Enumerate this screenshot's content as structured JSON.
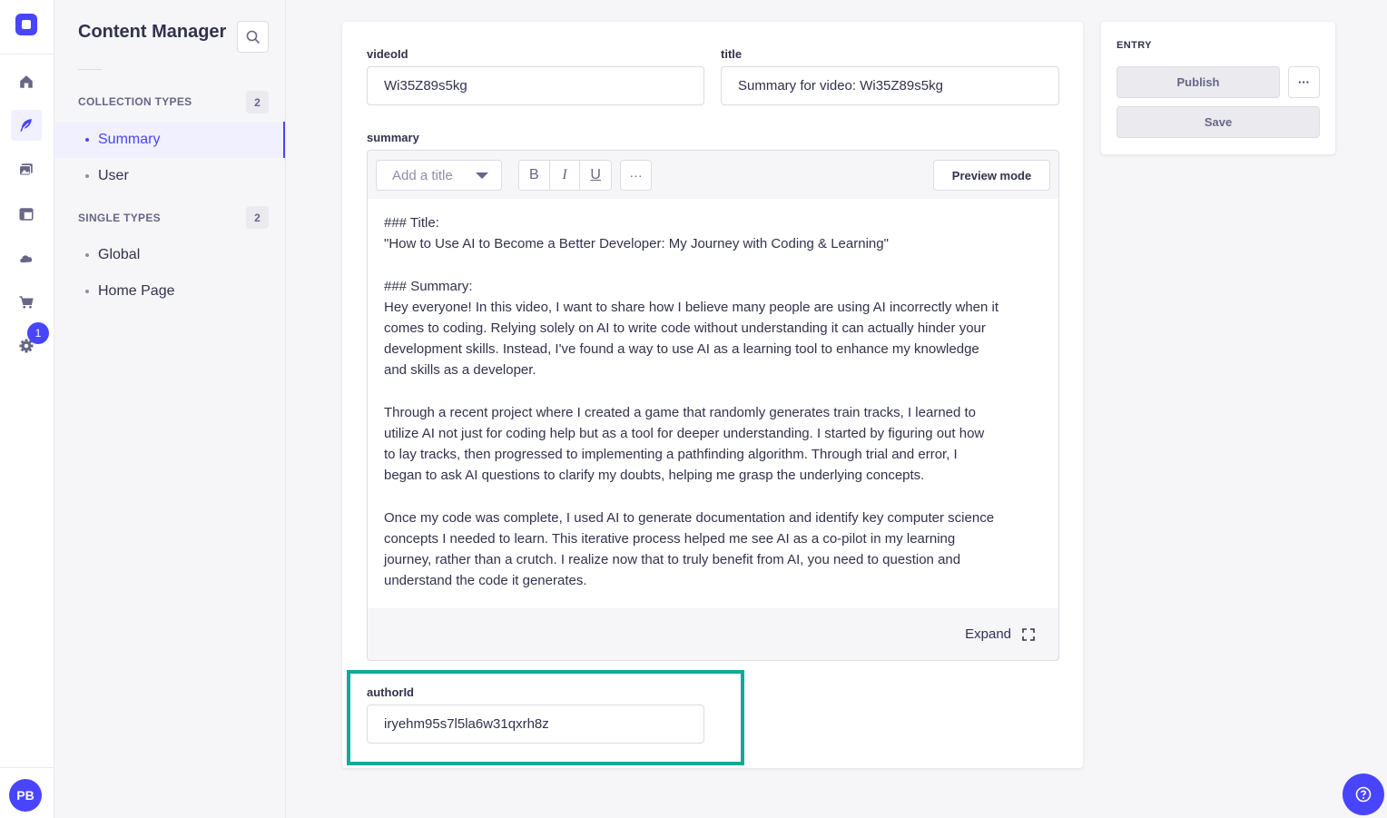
{
  "app": {
    "avatar_initials": "PB",
    "settings_badge": "1",
    "accent_color": "#4945ff",
    "highlight_color": "#14a89a"
  },
  "rail": {
    "icons": [
      "home-icon",
      "feather-icon",
      "media-icon",
      "layout-icon",
      "cloud-icon",
      "cart-icon",
      "gear-icon"
    ]
  },
  "sidebar": {
    "title": "Content Manager",
    "collection_label": "COLLECTION TYPES",
    "collection_count": "2",
    "collection_items": [
      "Summary",
      "User"
    ],
    "single_label": "SINGLE TYPES",
    "single_count": "2",
    "single_items": [
      "Global",
      "Home Page"
    ]
  },
  "form": {
    "videoId_label": "videoId",
    "videoId_value": "Wi35Z89s5kg",
    "title_label": "title",
    "title_value": "Summary for video: Wi35Z89s5kg",
    "summary_label": "summary",
    "editor": {
      "heading_placeholder": "Add a title",
      "bold": "B",
      "italic": "I",
      "underline": "U",
      "more": "···",
      "preview": "Preview mode",
      "expand": "Expand",
      "content": "### Title:\n\"How to Use AI to Become a Better Developer: My Journey with Coding & Learning\"\n\n### Summary:\nHey everyone! In this video, I want to share how I believe many people are using AI incorrectly when it\ncomes to coding. Relying solely on AI to write code without understanding it can actually hinder your\ndevelopment skills. Instead, I've found a way to use AI as a learning tool to enhance my knowledge\nand skills as a developer.\n\nThrough a recent project where I created a game that randomly generates train tracks, I learned to\nutilize AI not just for coding help but as a tool for deeper understanding. I started by figuring out how\nto lay tracks, then progressed to implementing a pathfinding algorithm. Through trial and error, I\nbegan to ask AI questions to clarify my doubts, helping me grasp the underlying concepts.\n\nOnce my code was complete, I used AI to generate documentation and identify key computer science\nconcepts I needed to learn. This iterative process helped me see AI as a co-pilot in my learning\njourney, rather than a crutch. I realize now that to truly benefit from AI, you need to question and\nunderstand the code it generates."
    },
    "authorId_label": "authorId",
    "authorId_value": "iryehm95s7l5la6w31qxrh8z"
  },
  "entry_panel": {
    "label": "ENTRY",
    "publish": "Publish",
    "more": "···",
    "save": "Save"
  }
}
